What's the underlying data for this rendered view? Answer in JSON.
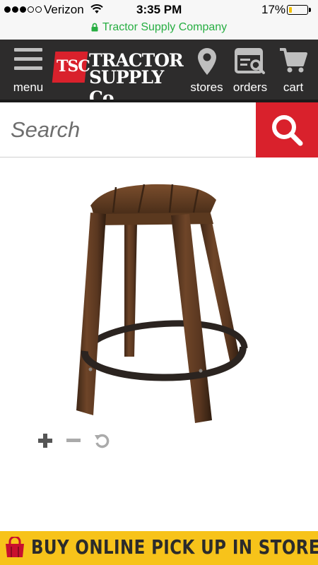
{
  "status_bar": {
    "carrier": "Verizon",
    "signal_bars_filled": 3,
    "signal_bars_total": 5,
    "time": "3:35 PM",
    "battery_percent": "17%",
    "battery_level": 0.17,
    "battery_color": "#f4c100"
  },
  "url_bar": {
    "site_name": "Tractor Supply Company",
    "color": "#27ae42"
  },
  "header": {
    "background": "#2d2c2c",
    "menu_label": "menu",
    "logo": {
      "badge": "TSC",
      "line1": "TRACTOR",
      "line2": "SUPPLY Co"
    },
    "stores_label": "stores",
    "orders_label": "orders",
    "cart_label": "cart"
  },
  "search": {
    "placeholder": "Search",
    "value": "",
    "button_color": "#d9212c",
    "icon": "search-icon"
  },
  "product": {
    "image": "wooden-barstool-image"
  },
  "zoom_controls": {
    "icons": [
      "zoom-in-icon",
      "zoom-out-icon",
      "reset-icon"
    ]
  },
  "banner": {
    "text": "BUY ONLINE PICK UP IN STORE",
    "background": "#f7c31a",
    "icon": "shopping-bag-icon"
  }
}
